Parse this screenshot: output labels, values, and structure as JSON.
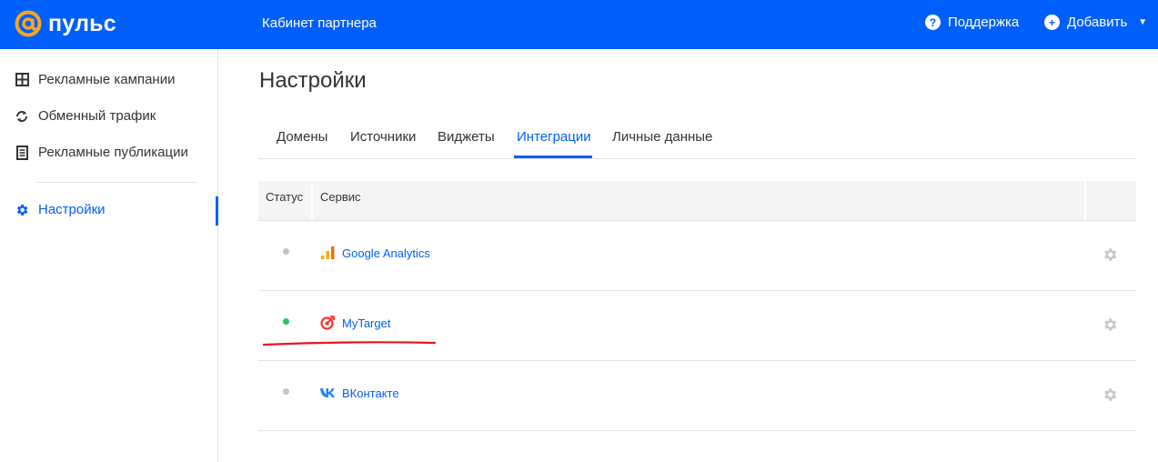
{
  "header": {
    "logo_text": "пульс",
    "cabinet_label": "Кабинет партнера",
    "support_label": "Поддержка",
    "add_label": "Добавить",
    "accent_color": "#005ff9",
    "logo_color": "#f5a623"
  },
  "sidebar": {
    "items": [
      {
        "label": "Рекламные кампании",
        "icon": "grid-icon"
      },
      {
        "label": "Обменный трафик",
        "icon": "exchange-icon"
      },
      {
        "label": "Рекламные публикации",
        "icon": "document-icon"
      },
      {
        "label": "Настройки",
        "icon": "gear-icon",
        "active": true
      }
    ]
  },
  "main": {
    "title": "Настройки",
    "tabs": [
      {
        "label": "Домены"
      },
      {
        "label": "Источники"
      },
      {
        "label": "Виджеты"
      },
      {
        "label": "Интеграции",
        "active": true
      },
      {
        "label": "Личные данные"
      }
    ],
    "table": {
      "columns": [
        "Статус",
        "Сервис"
      ],
      "rows": [
        {
          "service": "Google Analytics",
          "status_color": "#c4c4c4",
          "icon": "google-analytics-icon"
        },
        {
          "service": "MyTarget",
          "status_color": "#22c55e",
          "icon": "mytarget-icon"
        },
        {
          "service": "ВКонтакте",
          "status_color": "#c4c4c4",
          "icon": "vk-icon"
        }
      ]
    }
  }
}
